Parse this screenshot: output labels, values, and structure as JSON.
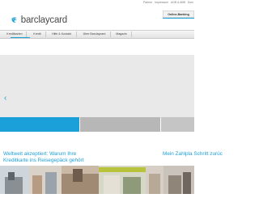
{
  "top_links": [
    "Partner",
    "Impressum",
    "AGB & ABB",
    "Dom"
  ],
  "logo": {
    "text": "barclaycard",
    "icon": "barclaycard-eagle-icon"
  },
  "online_banking": {
    "label": "Online-Banking"
  },
  "nav": {
    "items": [
      {
        "label": "Kreditkarten"
      },
      {
        "label": "Kredit"
      },
      {
        "label": "Hilfe & Kontakt"
      },
      {
        "label": "Über Barclaycard"
      },
      {
        "label": "Magazin"
      }
    ],
    "active_index": 0
  },
  "carousel": {
    "prev_icon": "chevron-left-icon",
    "active_tab": 0
  },
  "teasers": [
    {
      "title": "Weltweit akzeptiert: Warum Ihre Kreditkarte ins Reisegepäck gehört"
    },
    {
      "title": "Mein Zahlpla Schritt zurüc"
    }
  ],
  "colors": {
    "accent": "#1fa0d6",
    "nav_bg": "#ececec",
    "hero_bg": "#e9e9e9",
    "tab_inactive": "#b7b7b7"
  }
}
